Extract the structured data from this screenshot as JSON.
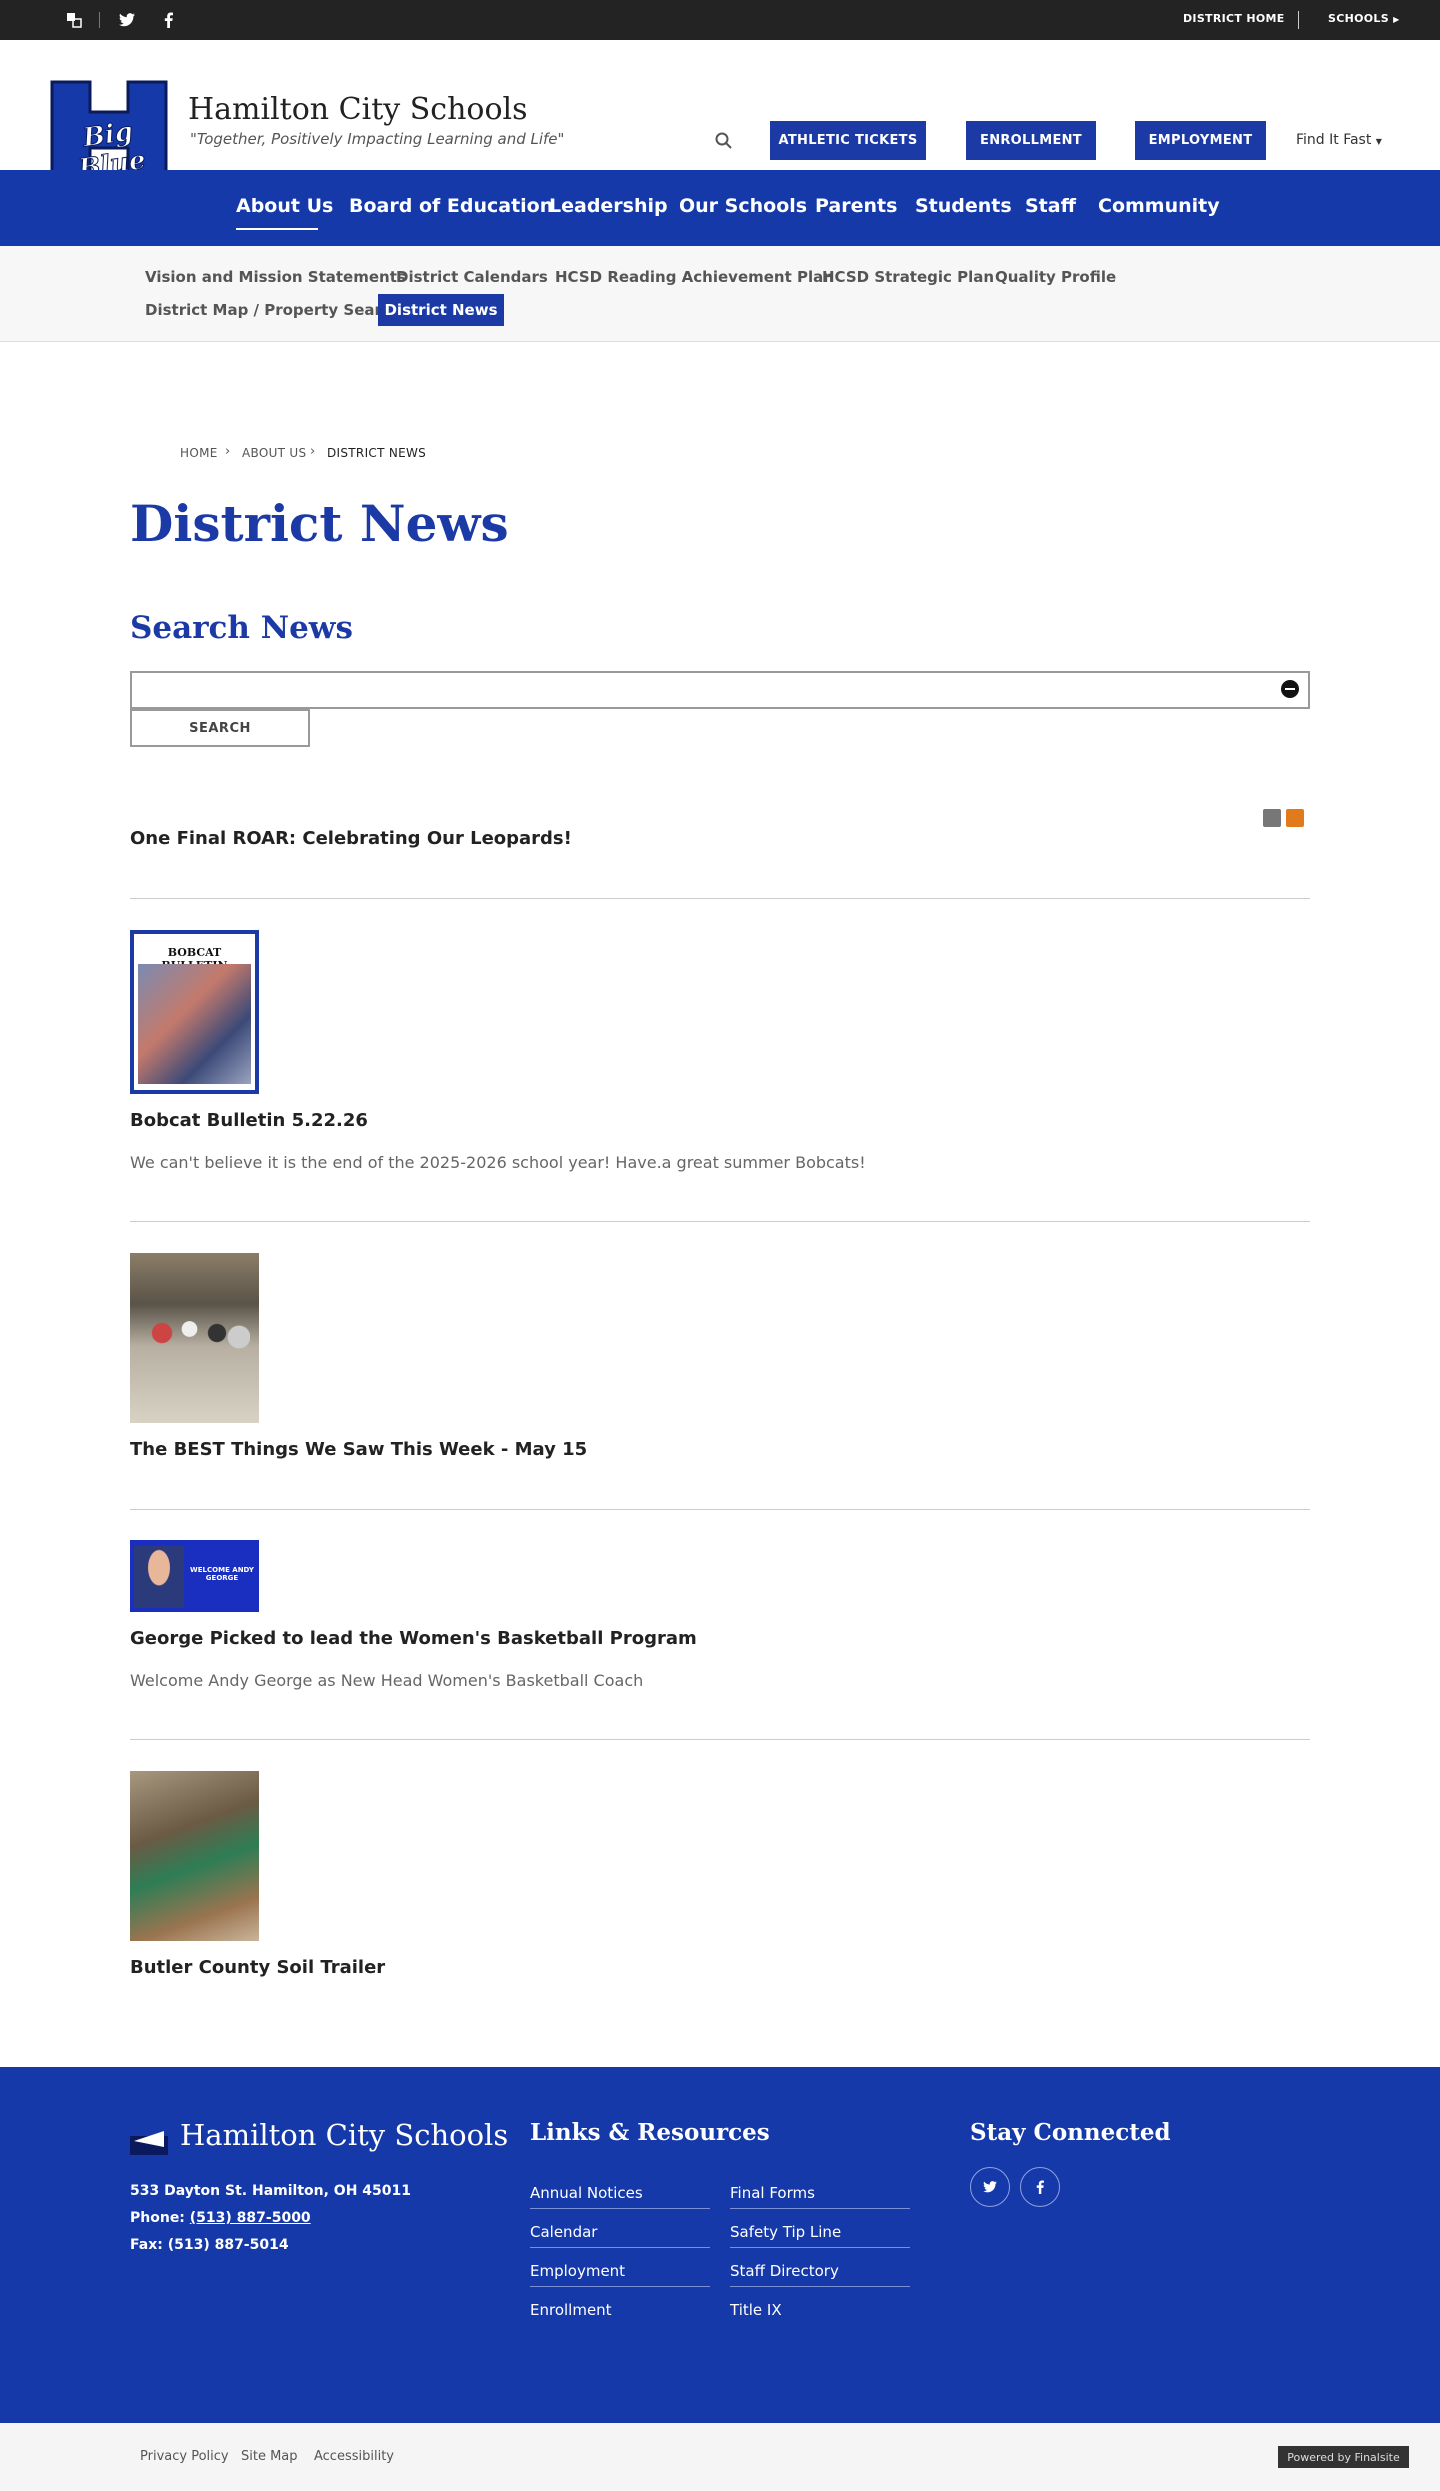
{
  "topbar": {
    "icons": [
      "translate-icon",
      "twitter-icon",
      "facebook-icon"
    ],
    "links": [
      "DISTRICT HOME",
      "SCHOOLS"
    ]
  },
  "header": {
    "logo_text": "Big Blue",
    "title": "Hamilton City Schools",
    "tagline": "\"Together, Positively Impacting Learning and Life\"",
    "buttons": [
      "ATHLETIC TICKETS",
      "ENROLLMENT",
      "EMPLOYMENT"
    ],
    "find_it_fast": "Find It Fast"
  },
  "mainnav": {
    "items": [
      "About Us",
      "Board of Education",
      "Leadership",
      "Our Schools",
      "Parents",
      "Students",
      "Staff",
      "Community"
    ],
    "active": "About Us"
  },
  "subnav": {
    "items": [
      "Vision and Mission Statements",
      "District Calendars",
      "HCSD Reading Achievement Plan",
      "HCSD Strategic Plan",
      "Quality Profile",
      "District Map / Property Search",
      "District News"
    ],
    "active": "District News"
  },
  "breadcrumb": [
    "HOME",
    "ABOUT US",
    "DISTRICT NEWS"
  ],
  "page_title": "District News",
  "search": {
    "heading": "Search News",
    "value": "",
    "button": "SEARCH"
  },
  "news": [
    {
      "title": "One Final ROAR: Celebrating Our Leopards!",
      "description": ""
    },
    {
      "title": "Bobcat Bulletin 5.22.26",
      "description": "We can't believe it is the end of the 2025-2026 school year!  Have.a great summer Bobcats!",
      "thumb_text": "BOBCAT BULLETIN"
    },
    {
      "title": "The BEST Things We Saw This Week - May 15",
      "description": ""
    },
    {
      "title": "George Picked to lead the Women's Basketball Program",
      "description": "Welcome Andy George as New Head Women's Basketball Coach",
      "thumb_text": "WELCOME ANDY GEORGE"
    },
    {
      "title": "Butler County Soil Trailer",
      "description": ""
    }
  ],
  "footer": {
    "title": "Hamilton City Schools",
    "address": "533 Dayton St. Hamilton, OH  45011",
    "phone_label": "Phone:",
    "phone": "(513) 887-5000",
    "fax": "Fax: (513) 887-5014",
    "links_heading": "Links & Resources",
    "links_col1": [
      "Annual Notices",
      "Calendar",
      "Employment",
      "Enrollment"
    ],
    "links_col2": [
      "Final Forms",
      "Safety Tip Line",
      "Staff Directory",
      "Title IX"
    ],
    "connected_heading": "Stay Connected"
  },
  "bottombar": {
    "links": [
      "Privacy Policy",
      "Site Map",
      "Accessibility"
    ],
    "powered": "Powered by Finalsite"
  },
  "colors": {
    "brand_blue": "#1539a9",
    "topbar": "#232323"
  }
}
